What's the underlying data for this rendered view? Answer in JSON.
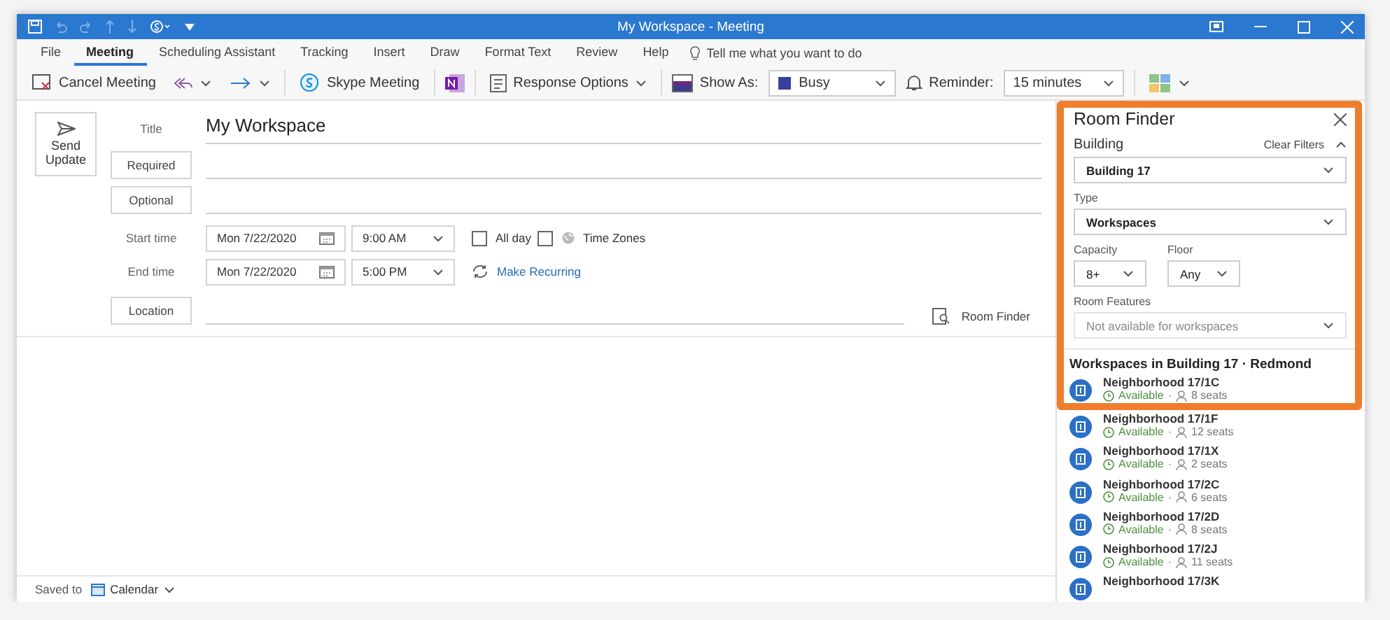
{
  "window": {
    "title": "My Workspace - Meeting"
  },
  "tabs": [
    {
      "label": "File",
      "selected": false
    },
    {
      "label": "Meeting",
      "selected": true
    },
    {
      "label": "Scheduling Assistant",
      "selected": false
    },
    {
      "label": "Tracking",
      "selected": false
    },
    {
      "label": "Insert",
      "selected": false
    },
    {
      "label": "Draw",
      "selected": false
    },
    {
      "label": "Format Text",
      "selected": false
    },
    {
      "label": "Review",
      "selected": false
    },
    {
      "label": "Help",
      "selected": false
    }
  ],
  "search": {
    "placeholder": "Tell me what you want to do"
  },
  "toolbar": {
    "cancel_meeting": "Cancel Meeting",
    "skype_meeting": "Skype Meeting",
    "response_options": "Response Options",
    "show_as_label": "Show As:",
    "show_as_value": "Busy",
    "reminder_label": "Reminder:",
    "reminder_value": "15 minutes"
  },
  "form": {
    "send_button": "Send Update",
    "title_label": "Title",
    "title_value": "My Workspace",
    "required_button": "Required",
    "optional_button": "Optional",
    "start_label": "Start time",
    "start_date": "Mon 7/22/2020",
    "start_time": "9:00 AM",
    "end_label": "End time",
    "end_date": "Mon 7/22/2020",
    "end_time": "5:00 PM",
    "all_day": {
      "label": "All day",
      "checked": false
    },
    "time_zones": {
      "label": "Time Zones",
      "checked": false
    },
    "make_recurring": "Make Recurring",
    "location_button": "Location",
    "room_finder_button": "Room Finder"
  },
  "status_bar": {
    "saved_to": "Saved to",
    "calendar": "Calendar"
  },
  "room_finder": {
    "title": "Room Finder",
    "building_label": "Building",
    "clear_filters": "Clear Filters",
    "building_value": "Building 17",
    "type_label": "Type",
    "type_value": "Workspaces",
    "capacity_label": "Capacity",
    "capacity_value": "8+",
    "floor_label": "Floor",
    "floor_value": "Any",
    "features_label": "Room Features",
    "features_placeholder": "Not available for workspaces",
    "features_disabled": true,
    "results_heading": "Workspaces in Building 17 · Redmond",
    "results": [
      {
        "name": "Neighborhood 17/1C",
        "status": "Available",
        "separator": "·",
        "seats": "8 seats"
      },
      {
        "name": "Neighborhood 17/1F",
        "status": "Available",
        "separator": "·",
        "seats": "12 seats"
      },
      {
        "name": "Neighborhood 17/1X",
        "status": "Available",
        "separator": "·",
        "seats": "2 seats"
      },
      {
        "name": "Neighborhood 17/2C",
        "status": "Available",
        "separator": "·",
        "seats": "6 seats"
      },
      {
        "name": "Neighborhood 17/2D",
        "status": "Available",
        "separator": "·",
        "seats": "8 seats"
      },
      {
        "name": "Neighborhood 17/2J",
        "status": "Available",
        "separator": "·",
        "seats": "11 seats"
      },
      {
        "name": "Neighborhood 17/3K"
      }
    ]
  }
}
